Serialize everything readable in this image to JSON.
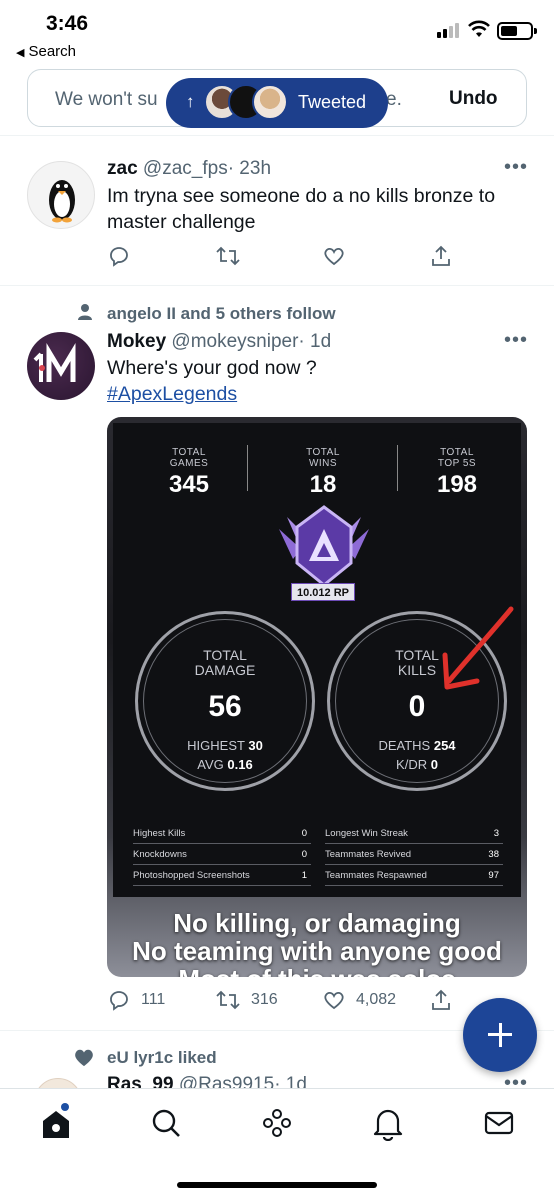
{
  "status_bar": {
    "time": "3:46",
    "back_label": "Search"
  },
  "toast": {
    "text_left": "We won't su",
    "text_right": "e.",
    "undo_label": "Undo",
    "pill_label": "Tweeted"
  },
  "tweets": [
    {
      "name": "zac",
      "handle": "@zac_fps",
      "time": "· 23h",
      "text": "Im tryna see someone do a no kills bronze to master challenge",
      "more": "•••"
    },
    {
      "social_context": "angelo II and 5 others follow",
      "name": "Mokey",
      "handle": "@mokeysniper",
      "time": "· 1d",
      "text": "Where's your god now ?",
      "hashtag": "#ApexLegends",
      "more": "•••",
      "reply_count": "111",
      "retweet_count": "316",
      "like_count": "4,082",
      "media": {
        "stats": [
          {
            "title1": "TOTAL",
            "title2": "GAMES",
            "value": "345"
          },
          {
            "title1": "TOTAL",
            "title2": "WINS",
            "value": "18"
          },
          {
            "title1": "TOTAL",
            "title2": "TOP 5S",
            "value": "198"
          }
        ],
        "rp": "10.012 RP",
        "damage": {
          "title1": "TOTAL",
          "title2": "DAMAGE",
          "value": "56",
          "s1_label": "HIGHEST",
          "s1_value": "30",
          "s2_label": "AVG",
          "s2_value": "0.16"
        },
        "kills": {
          "title1": "TOTAL",
          "title2": "KILLS",
          "value": "0",
          "s1_label": "DEATHS",
          "s1_value": "254",
          "s2_label": "K/DR",
          "s2_value": "0"
        },
        "left_table": [
          {
            "label": "Highest Kills",
            "value": "0"
          },
          {
            "label": "Knockdowns",
            "value": "0"
          },
          {
            "label": "Photoshopped Screenshots",
            "value": "1"
          }
        ],
        "right_table": [
          {
            "label": "Longest Win Streak",
            "value": "3"
          },
          {
            "label": "Teammates Revived",
            "value": "38"
          },
          {
            "label": "Teammates Respawned",
            "value": "97"
          }
        ],
        "caption_line1": "No killing, or damaging",
        "caption_line2": "No teaming with anyone good",
        "caption_line3": "Most of this was solos"
      }
    },
    {
      "social_context": "eU lyr1c liked",
      "name": "Ras_99",
      "handle": "@Ras9915",
      "time": "· 1d",
      "more": "•••"
    }
  ],
  "colors": {
    "accent": "#1d4597",
    "text_secondary": "#536471",
    "link": "#1d4fa3"
  },
  "icons": [
    "search-icon",
    "reply-icon",
    "retweet-icon",
    "like-icon",
    "share-icon",
    "home-icon",
    "spaces-icon",
    "notifications-icon",
    "messages-icon",
    "compose-icon"
  ]
}
